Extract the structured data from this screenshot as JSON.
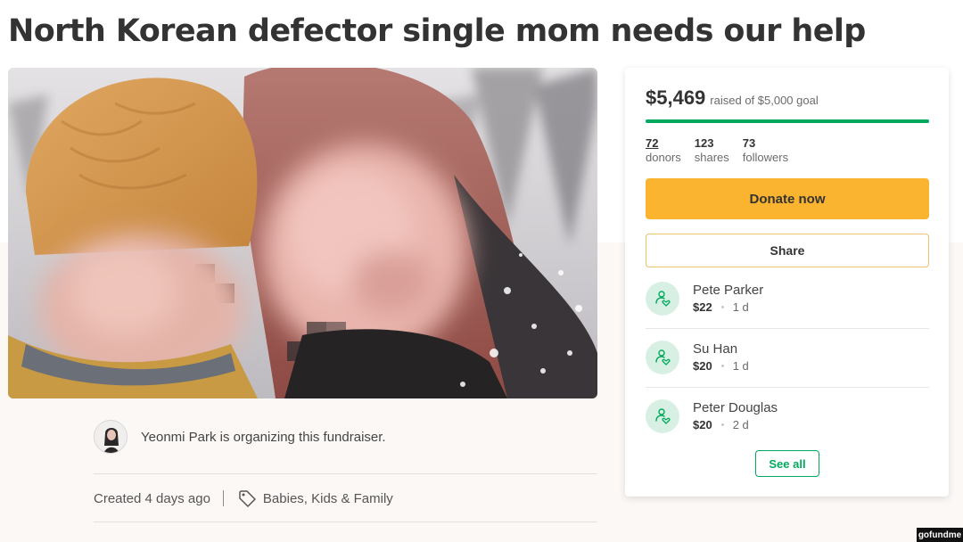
{
  "page": {
    "title": "North Korean defector single mom needs our help"
  },
  "organizer": {
    "text": "Yeonmi Park is organizing this fundraiser."
  },
  "meta": {
    "created": "Created 4 days ago",
    "category": "Babies, Kids & Family"
  },
  "panel": {
    "raised_amount": "$5,469",
    "raised_goal": "raised of $5,000 goal",
    "progress_fraction": 1.0,
    "stats": [
      {
        "num": "72",
        "label": "donors"
      },
      {
        "num": "123",
        "label": "shares"
      },
      {
        "num": "73",
        "label": "followers"
      }
    ],
    "donate_label": "Donate now",
    "share_label": "Share",
    "donations": [
      {
        "name": "Pete Parker",
        "amount": "$22",
        "time": "1 d"
      },
      {
        "name": "Su Han",
        "amount": "$20",
        "time": "1 d"
      },
      {
        "name": "Peter Douglas",
        "amount": "$20",
        "time": "2 d"
      }
    ],
    "see_all_label": "See all"
  },
  "watermark": {
    "text": "gofundme"
  },
  "colors": {
    "accent_green": "#02a95c",
    "donate_yellow": "#fbb430",
    "donor_icon_bg": "#d8f0e4"
  },
  "icons": {
    "tag": "tag-icon",
    "donor": "donor-heart-hand-icon"
  }
}
